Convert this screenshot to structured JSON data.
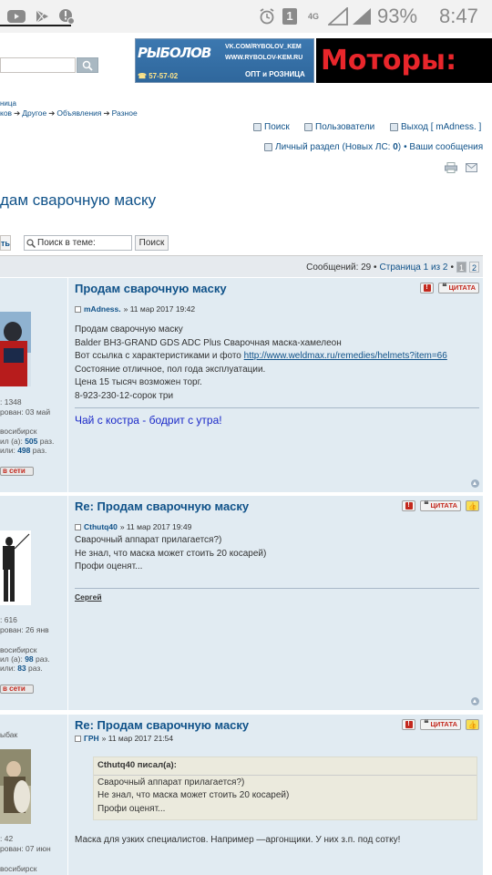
{
  "status_bar": {
    "battery": "93%",
    "time": "8:47",
    "network": "4G",
    "notification_count": "1"
  },
  "header": {
    "search_button_label": "",
    "ad1": {
      "logo": "РЫБОЛОВ",
      "vk": "VK.COM/RYBOLOV_KEM",
      "www": "WWW.RYBOLOV-KEM.RU",
      "phone": "57-57-02",
      "opt": "ОПТ и РОЗНИЦА"
    },
    "ad2": {
      "text": "Моторы:"
    }
  },
  "breadcrumbs": {
    "line1": "ница",
    "items": [
      "ков",
      "Другое",
      "Объявления",
      "Разное"
    ]
  },
  "nav": {
    "search": "Поиск",
    "users": "Пользователи",
    "logout": "Выход [ mAdness. ]",
    "private": "Личный раздел (Новых ЛС: ",
    "private_count": "0",
    "private_end": ")",
    "your_posts": "• Ваши сообщения"
  },
  "topic": {
    "title": "дам сварочную маску"
  },
  "toolbar": {
    "reply_fragment": "ть",
    "search_placeholder": "Поиск в теме:",
    "search_button": "Поиск"
  },
  "pagination": {
    "messages": "Сообщений: 29 •",
    "page_text": "Страница 1 из 2",
    "dot": "•",
    "pages": [
      "1",
      "2"
    ]
  },
  "buttons": {
    "quote": "ЦИТАТА",
    "online": "в сети"
  },
  "posts": [
    {
      "title": "Продам сварочную маску",
      "author": "mAdness.",
      "date": "» 11 мар 2017 19:42",
      "lines": [
        "Продам сварочную маску",
        "Balder BH3-GRAND GDS ADC Plus Сварочная маска-хамелеон",
        "Вот ссылка с характеристиками и фото ",
        "Состояние отличное, пол года эксплуатации.",
        "Цена 15 тысяч возможен торг.",
        "8-923-230-12-сорок три"
      ],
      "link": "http://www.weldmax.ru/remedies/helmets?item=66",
      "signature": "Чай с костра - бодрит с утра!",
      "profile": {
        "posts_label": ": 1348",
        "reg": "рован: 03 май",
        "city": "восибирск",
        "thanked_label": "ил (а): ",
        "thanked": "505",
        "thanked_unit": " раз.",
        "got_label": "или: ",
        "got": "498",
        "got_unit": " раз."
      }
    },
    {
      "title": "Re: Продам сварочную маску",
      "author": "Cthutq40",
      "date": "» 11 мар 2017 19:49",
      "lines": [
        "Сварочный аппарат прилагается?)",
        "Не знал, что маска может стоить 20 косарей)",
        "Профи оценят..."
      ],
      "signature": "Сергей",
      "profile": {
        "posts_label": ": 616",
        "reg": "рован: 26 янв",
        "city": "восибирск",
        "thanked_label": "ил (а): ",
        "thanked": "98",
        "thanked_unit": " раз.",
        "got_label": "или: ",
        "got": "83",
        "got_unit": " раз."
      }
    },
    {
      "title": "Re: Продам сварочную маску",
      "author": "ГРН",
      "date": "» 11 мар 2017 21:54",
      "quote_header": "Cthutq40 писал(а):",
      "quote_lines": [
        "Сварочный аппарат прилагается?)",
        "Не знал, что маска может стоить 20 косарей)",
        "Профи оценят..."
      ],
      "text": "Маска для узких специалистов. Например —аргонщики. У них з.п. под сотку!",
      "profile": {
        "rank": "ыбак",
        "posts_label": ": 42",
        "reg": "рован: 07 июн",
        "city": "восибирск"
      }
    }
  ]
}
